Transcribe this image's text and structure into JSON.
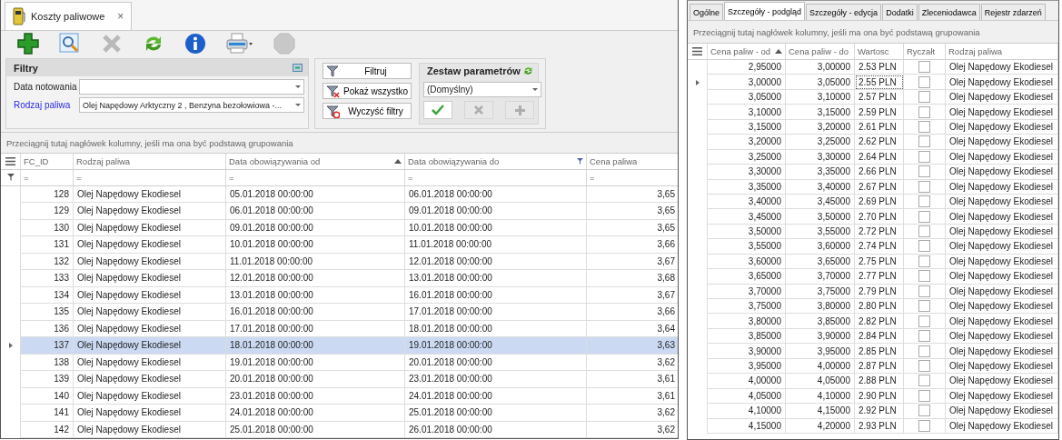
{
  "left": {
    "tab": {
      "title": "Koszty paliwowe",
      "close": "×"
    },
    "toolbar": [
      {
        "kind": "add",
        "disabled": false
      },
      {
        "kind": "preview",
        "disabled": false
      },
      {
        "kind": "delete",
        "disabled": true
      },
      {
        "kind": "refresh",
        "disabled": false
      },
      {
        "kind": "info",
        "disabled": false
      },
      {
        "kind": "print",
        "disabled": false
      },
      {
        "kind": "stop",
        "disabled": true
      }
    ],
    "filters": {
      "title": "Filtry",
      "fields": [
        {
          "label": "Data notowania",
          "highlighted": false
        },
        {
          "label": "Rodzaj paliwa",
          "value": "Olej Napędowy Arktyczny 2 , Benzyna bezołowiowa -...",
          "highlighted": true
        }
      ]
    },
    "filter_buttons": [
      {
        "kind": "filter",
        "label": "Filtruj"
      },
      {
        "kind": "show_all",
        "label": "Pokaż wszystko"
      },
      {
        "kind": "clear",
        "label": "Wyczyść filtry"
      }
    ],
    "parameter_set": {
      "title": "Zestaw parametrów",
      "value": "(Domyślny)",
      "buttons": [
        {
          "kind": "apply",
          "disabled": false
        },
        {
          "kind": "delete",
          "disabled": true
        },
        {
          "kind": "add",
          "disabled": true
        }
      ]
    },
    "group_hint": "Przeciągnij tutaj nagłówek kolumny, jeśli ma ona być podstawą grupowania",
    "columns": [
      {
        "label": "FC_ID",
        "sorted": false,
        "filtered": false,
        "filter": "="
      },
      {
        "label": "Rodzaj paliwa",
        "sorted": false,
        "filtered": false,
        "filter": "="
      },
      {
        "label": "Data obowiązywania od",
        "sorted": true,
        "filtered": false,
        "filter": "="
      },
      {
        "label": "Data obowiązywania do",
        "sorted": false,
        "filtered": true,
        "filter": "="
      },
      {
        "label": "Cena paliwa",
        "sorted": false,
        "filtered": false,
        "filter": "="
      }
    ],
    "rows": [
      {
        "id": "128",
        "fuel": "Olej Napędowy Ekodiesel",
        "from": "05.01.2018 00:00:00",
        "to": "06.01.2018 00:00:00",
        "price": "3,65",
        "selected": false
      },
      {
        "id": "129",
        "fuel": "Olej Napędowy Ekodiesel",
        "from": "06.01.2018 00:00:00",
        "to": "09.01.2018 00:00:00",
        "price": "3,65",
        "selected": false
      },
      {
        "id": "130",
        "fuel": "Olej Napędowy Ekodiesel",
        "from": "09.01.2018 00:00:00",
        "to": "10.01.2018 00:00:00",
        "price": "3,65",
        "selected": false
      },
      {
        "id": "131",
        "fuel": "Olej Napędowy Ekodiesel",
        "from": "10.01.2018 00:00:00",
        "to": "11.01.2018 00:00:00",
        "price": "3,66",
        "selected": false
      },
      {
        "id": "132",
        "fuel": "Olej Napędowy Ekodiesel",
        "from": "11.01.2018 00:00:00",
        "to": "12.01.2018 00:00:00",
        "price": "3,67",
        "selected": false
      },
      {
        "id": "133",
        "fuel": "Olej Napędowy Ekodiesel",
        "from": "12.01.2018 00:00:00",
        "to": "13.01.2018 00:00:00",
        "price": "3,68",
        "selected": false
      },
      {
        "id": "134",
        "fuel": "Olej Napędowy Ekodiesel",
        "from": "13.01.2018 00:00:00",
        "to": "16.01.2018 00:00:00",
        "price": "3,67",
        "selected": false
      },
      {
        "id": "135",
        "fuel": "Olej Napędowy Ekodiesel",
        "from": "16.01.2018 00:00:00",
        "to": "17.01.2018 00:00:00",
        "price": "3,66",
        "selected": false
      },
      {
        "id": "136",
        "fuel": "Olej Napędowy Ekodiesel",
        "from": "17.01.2018 00:00:00",
        "to": "18.01.2018 00:00:00",
        "price": "3,64",
        "selected": false
      },
      {
        "id": "137",
        "fuel": "Olej Napędowy Ekodiesel",
        "from": "18.01.2018 00:00:00",
        "to": "19.01.2018 00:00:00",
        "price": "3,63",
        "selected": true
      },
      {
        "id": "138",
        "fuel": "Olej Napędowy Ekodiesel",
        "from": "19.01.2018 00:00:00",
        "to": "20.01.2018 00:00:00",
        "price": "3,62",
        "selected": false
      },
      {
        "id": "139",
        "fuel": "Olej Napędowy Ekodiesel",
        "from": "20.01.2018 00:00:00",
        "to": "23.01.2018 00:00:00",
        "price": "3,61",
        "selected": false
      },
      {
        "id": "140",
        "fuel": "Olej Napędowy Ekodiesel",
        "from": "23.01.2018 00:00:00",
        "to": "24.01.2018 00:00:00",
        "price": "3,61",
        "selected": false
      },
      {
        "id": "141",
        "fuel": "Olej Napędowy Ekodiesel",
        "from": "24.01.2018 00:00:00",
        "to": "25.01.2018 00:00:00",
        "price": "3,62",
        "selected": false
      },
      {
        "id": "142",
        "fuel": "Olej Napędowy Ekodiesel",
        "from": "25.01.2018 00:00:00",
        "to": "26.01.2018 00:00:00",
        "price": "3,62",
        "selected": false
      }
    ]
  },
  "right": {
    "tabs": [
      {
        "label": "Ogólne",
        "selected": false
      },
      {
        "label": "Szczegóły - podgląd",
        "selected": true
      },
      {
        "label": "Szczegóły - edycja",
        "selected": false
      },
      {
        "label": "Dodatki",
        "selected": false
      },
      {
        "label": "Zleceniodawca",
        "selected": false
      },
      {
        "label": "Rejestr zdarzeń",
        "selected": false
      }
    ],
    "group_hint": "Przeciągnij tutaj nagłówek kolumny, jeśli ma ona być podstawą grupowania",
    "columns": [
      {
        "label": "Cena paliw - od",
        "sorted": true
      },
      {
        "label": "Cena paliw - do",
        "sorted": false
      },
      {
        "label": "Wartosc",
        "sorted": false
      },
      {
        "label": "Ryczałt",
        "sorted": false
      },
      {
        "label": "Rodzaj paliwa",
        "sorted": false
      }
    ],
    "rows": [
      {
        "from": "2,95000",
        "to": "3,00000",
        "value": "2.53 PLN",
        "flat": false,
        "fuel": "Olej Napędowy Ekodiesel",
        "selected": false
      },
      {
        "from": "3,00000",
        "to": "3,05000",
        "value": "2.55 PLN",
        "flat": false,
        "fuel": "Olej Napędowy Ekodiesel",
        "selected": true
      },
      {
        "from": "3,05000",
        "to": "3,10000",
        "value": "2.57 PLN",
        "flat": false,
        "fuel": "Olej Napędowy Ekodiesel",
        "selected": false
      },
      {
        "from": "3,10000",
        "to": "3,15000",
        "value": "2.59 PLN",
        "flat": false,
        "fuel": "Olej Napędowy Ekodiesel",
        "selected": false
      },
      {
        "from": "3,15000",
        "to": "3,20000",
        "value": "2.61 PLN",
        "flat": false,
        "fuel": "Olej Napędowy Ekodiesel",
        "selected": false
      },
      {
        "from": "3,20000",
        "to": "3,25000",
        "value": "2.62 PLN",
        "flat": false,
        "fuel": "Olej Napędowy Ekodiesel",
        "selected": false
      },
      {
        "from": "3,25000",
        "to": "3,30000",
        "value": "2.64 PLN",
        "flat": false,
        "fuel": "Olej Napędowy Ekodiesel",
        "selected": false
      },
      {
        "from": "3,30000",
        "to": "3,35000",
        "value": "2.66 PLN",
        "flat": false,
        "fuel": "Olej Napędowy Ekodiesel",
        "selected": false
      },
      {
        "from": "3,35000",
        "to": "3,40000",
        "value": "2.67 PLN",
        "flat": false,
        "fuel": "Olej Napędowy Ekodiesel",
        "selected": false
      },
      {
        "from": "3,40000",
        "to": "3,45000",
        "value": "2.69 PLN",
        "flat": false,
        "fuel": "Olej Napędowy Ekodiesel",
        "selected": false
      },
      {
        "from": "3,45000",
        "to": "3,50000",
        "value": "2.70 PLN",
        "flat": false,
        "fuel": "Olej Napędowy Ekodiesel",
        "selected": false
      },
      {
        "from": "3,50000",
        "to": "3,55000",
        "value": "2.72 PLN",
        "flat": false,
        "fuel": "Olej Napędowy Ekodiesel",
        "selected": false
      },
      {
        "from": "3,55000",
        "to": "3,60000",
        "value": "2.74 PLN",
        "flat": false,
        "fuel": "Olej Napędowy Ekodiesel",
        "selected": false
      },
      {
        "from": "3,60000",
        "to": "3,65000",
        "value": "2.75 PLN",
        "flat": false,
        "fuel": "Olej Napędowy Ekodiesel",
        "selected": false
      },
      {
        "from": "3,65000",
        "to": "3,70000",
        "value": "2.77 PLN",
        "flat": false,
        "fuel": "Olej Napędowy Ekodiesel",
        "selected": false
      },
      {
        "from": "3,70000",
        "to": "3,75000",
        "value": "2.79 PLN",
        "flat": false,
        "fuel": "Olej Napędowy Ekodiesel",
        "selected": false
      },
      {
        "from": "3,75000",
        "to": "3,80000",
        "value": "2.80 PLN",
        "flat": false,
        "fuel": "Olej Napędowy Ekodiesel",
        "selected": false
      },
      {
        "from": "3,80000",
        "to": "3,85000",
        "value": "2.82 PLN",
        "flat": false,
        "fuel": "Olej Napędowy Ekodiesel",
        "selected": false
      },
      {
        "from": "3,85000",
        "to": "3,90000",
        "value": "2.84 PLN",
        "flat": false,
        "fuel": "Olej Napędowy Ekodiesel",
        "selected": false
      },
      {
        "from": "3,90000",
        "to": "3,95000",
        "value": "2.85 PLN",
        "flat": false,
        "fuel": "Olej Napędowy Ekodiesel",
        "selected": false
      },
      {
        "from": "3,95000",
        "to": "4,00000",
        "value": "2.87 PLN",
        "flat": false,
        "fuel": "Olej Napędowy Ekodiesel",
        "selected": false
      },
      {
        "from": "4,00000",
        "to": "4,05000",
        "value": "2.88 PLN",
        "flat": false,
        "fuel": "Olej Napędowy Ekodiesel",
        "selected": false
      },
      {
        "from": "4,05000",
        "to": "4,10000",
        "value": "2.90 PLN",
        "flat": false,
        "fuel": "Olej Napędowy Ekodiesel",
        "selected": false
      },
      {
        "from": "4,10000",
        "to": "4,15000",
        "value": "2.92 PLN",
        "flat": false,
        "fuel": "Olej Napędowy Ekodiesel",
        "selected": false
      },
      {
        "from": "4,15000",
        "to": "4,20000",
        "value": "2.93 PLN",
        "flat": false,
        "fuel": "Olej Napędowy Ekodiesel",
        "selected": false
      }
    ]
  }
}
